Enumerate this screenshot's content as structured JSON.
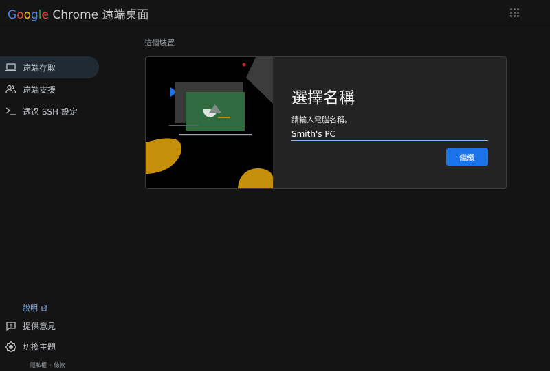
{
  "header": {
    "logo_letters": [
      "G",
      "o",
      "o",
      "g",
      "l",
      "e"
    ],
    "app_name": "Chrome 遠端桌面",
    "apps_icon": "apps-grid-icon"
  },
  "nav": {
    "items": [
      {
        "label": "遠端存取",
        "icon": "laptop-icon",
        "active": true
      },
      {
        "label": "遠端支援",
        "icon": "people-icon",
        "active": false
      },
      {
        "label": "透過 SSH 設定",
        "icon": "terminal-icon",
        "active": false
      }
    ]
  },
  "main": {
    "section_label": "這個裝置",
    "card": {
      "title": "選擇名稱",
      "prompt": "請輸入電腦名稱。",
      "input_value": "Smith's PC",
      "button_label": "繼續"
    }
  },
  "sidebar_bottom": {
    "help_label": "說明",
    "feedback_label": "提供意見",
    "theme_label": "切換主題",
    "privacy_label": "隱私權",
    "separator": "·",
    "terms_label": "條款"
  },
  "colors": {
    "background": "#141414",
    "accent": "#1a73e8",
    "link": "#8ab4f8",
    "card": "#232323",
    "illustration_yellow": "#c58f0b",
    "illustration_green": "#2f6b3f"
  }
}
